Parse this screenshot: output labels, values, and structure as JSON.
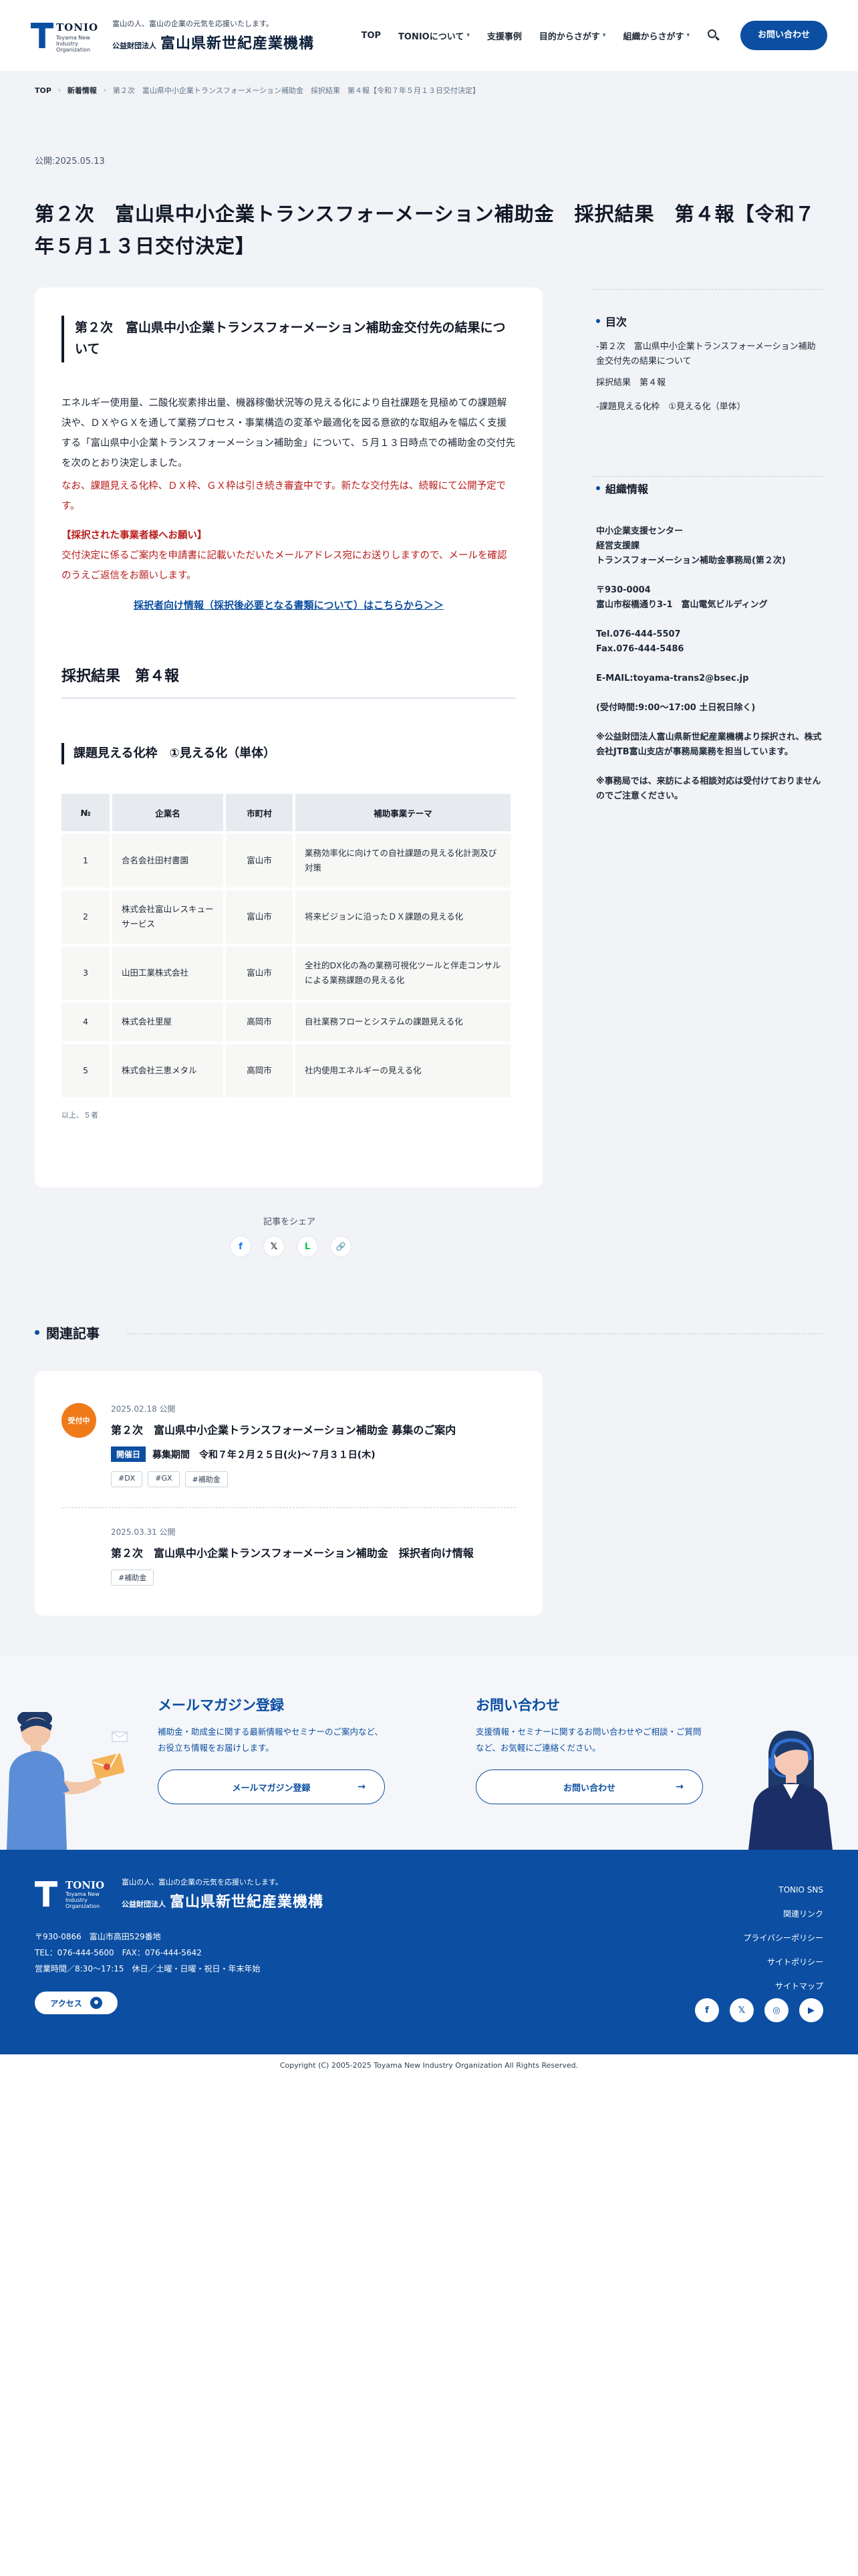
{
  "header": {
    "logo_word": "TONIO",
    "logo_sub": "Toyama New Industry Organization",
    "tagline": "富山の人、富山の企業の元気を応援いたします。",
    "org_small": "公益財団法人",
    "org_name": "富山県新世紀産業機構",
    "nav": [
      "TOP",
      "TONIOについて",
      "支援事例",
      "目的からさがす",
      "組織からさがす"
    ],
    "contact": "お問い合わせ"
  },
  "breadcrumb": {
    "top": "TOP",
    "news": "新着情報",
    "current": "第２次　富山県中小企業トランスフォーメーション補助金　採択結果　第４報【令和７年５月１３日交付決定】"
  },
  "article": {
    "date": "公開:2025.05.13",
    "title": "第２次　富山県中小企業トランスフォーメーション補助金　採択結果　第４報【令和７年５月１３日交付決定】",
    "section_head": "第２次　富山県中小企業トランスフォーメーション補助金交付先の結果について",
    "body": "エネルギー使用量、二酸化炭素排出量、機器稼働状況等の見える化により自社課題を見極めての課題解決や、ＤＸやＧＸを通して業務プロセス・事業構造の変革や最適化を図る意欲的な取組みを幅広く支援する「富山県中小企業トランスフォーメーション補助金」について、５月１３日時点での補助金の交付先を次のとおり決定しました。",
    "red_note": "なお、課題見える化枠、ＤＸ枠、ＧＸ枠は引き続き審査中です。新たな交付先は、続報にて公開予定です。",
    "red_heading": "【採択された事業者様へお願い】",
    "red_body": "交付決定に係るご案内を申請書に記載いただいたメールアドレス宛にお送りしますので、メールを確認のうえご返信をお願いします。",
    "link": "採択者向け情報（採択後必要となる書類について）はこちらから＞＞",
    "result_head": "採択結果　第４報",
    "sub_head": "課題見える化枠　①見える化（単体）",
    "table": {
      "headers": [
        "№",
        "企業名",
        "市町村",
        "補助事業テーマ"
      ],
      "rows": [
        [
          "1",
          "合名会社田村書園",
          "富山市",
          "業務効率化に向けての自社課題の見える化計測及び対策"
        ],
        [
          "2",
          "株式会社富山レスキューサービス",
          "富山市",
          "将来ビジョンに沿ったＤＸ課題の見える化"
        ],
        [
          "3",
          "山田工業株式会社",
          "富山市",
          "全社的DX化の為の業務可視化ツールと伴走コンサルによる業務課題の見える化"
        ],
        [
          "4",
          "株式会社里屋",
          "高岡市",
          "自社業務フローとシステムの課題見える化"
        ],
        [
          "5",
          "株式会社三恵メタル",
          "高岡市",
          "社内使用エネルギーの見える化"
        ]
      ]
    },
    "table_note": "以上、５者"
  },
  "share": {
    "label": "記事をシェア",
    "buttons": [
      "f",
      "𝕏",
      "L",
      "🔗"
    ]
  },
  "sidebar": {
    "toc_head": "目次",
    "toc": [
      "-第２次　富山県中小企業トランスフォーメーション補助金交付先の結果について",
      "採択結果　第４報",
      "-課題見える化枠　①見える化（単体）"
    ],
    "org_head": "組織情報",
    "org_lines": [
      "中小企業支援センター",
      "経営支援課",
      "トランスフォーメーション補助金事務局(第２次)",
      "",
      "〒930-0004",
      "富山市桜橋通り3-1　富山電気ビルディング",
      "",
      "Tel.076-444-5507",
      "Fax.076-444-5486",
      "",
      "E-MAIL:toyama-trans2@bsec.jp",
      "",
      "(受付時間:9:00〜17:00 土日祝日除く)",
      "",
      "※公益財団法人富山県新世紀産業機構より採択され、株式会社JTB富山支店が事務局業務を担当しています。",
      "",
      "※事務局では、来訪による相談対応は受付けておりませんのでご注意ください。"
    ]
  },
  "related": {
    "head": "関連記事",
    "items": [
      {
        "badge": "受付中",
        "date": "2025.02.18 公開",
        "title": "第２次　富山県中小企業トランスフォーメーション補助金 募集のご案内",
        "period_tag": "開催日",
        "period": "募集期間　令和７年２月２５日(火)〜７月３１日(木)",
        "tags": [
          "#DX",
          "#GX",
          "#補助金"
        ]
      },
      {
        "date": "2025.03.31 公開",
        "title": "第２次　富山県中小企業トランスフォーメーション補助金　採択者向け情報",
        "tags": [
          "#補助金"
        ]
      }
    ]
  },
  "cta": {
    "mail_head": "メールマガジン登録",
    "mail_body": "補助金・助成金に関する最新情報やセミナーのご案内など、お役立ち情報をお届けします。",
    "mail_btn": "メールマガジン登録",
    "contact_head": "お問い合わせ",
    "contact_body": "支援情報・セミナーに関するお問い合わせやご相談・ご質問など、お気軽にご連絡ください。",
    "contact_btn": "お問い合わせ"
  },
  "footer": {
    "address": "〒930-0866　富山市高田529番地",
    "tel": "TEL：076-444-5600　FAX：076-444-5642",
    "hours": "営業時間／8:30〜17:15　休日／土曜・日曜・祝日・年末年始",
    "access": "アクセス",
    "links": [
      "TONIO SNS",
      "関連リンク",
      "プライバシーポリシー",
      "サイトポリシー",
      "サイトマップ"
    ],
    "social": [
      "f",
      "𝕏",
      "◎",
      "▶"
    ],
    "copyright": "Copyright (C) 2005-2025 Toyama New Industry Organization All Rights Reserved."
  },
  "colors": {
    "brand": "#0b4ea2",
    "alert": "#b91c1c",
    "badge": "#f07a1a",
    "band": "#f1f3f6"
  }
}
